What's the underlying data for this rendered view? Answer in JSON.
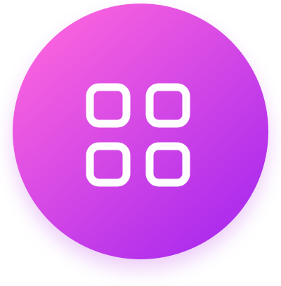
{
  "app_icon": {
    "icon": "grid-icon",
    "colors": {
      "gradient_start": "#F962DE",
      "gradient_end": "#A728EE",
      "glyph": "#FFFFFF"
    }
  }
}
